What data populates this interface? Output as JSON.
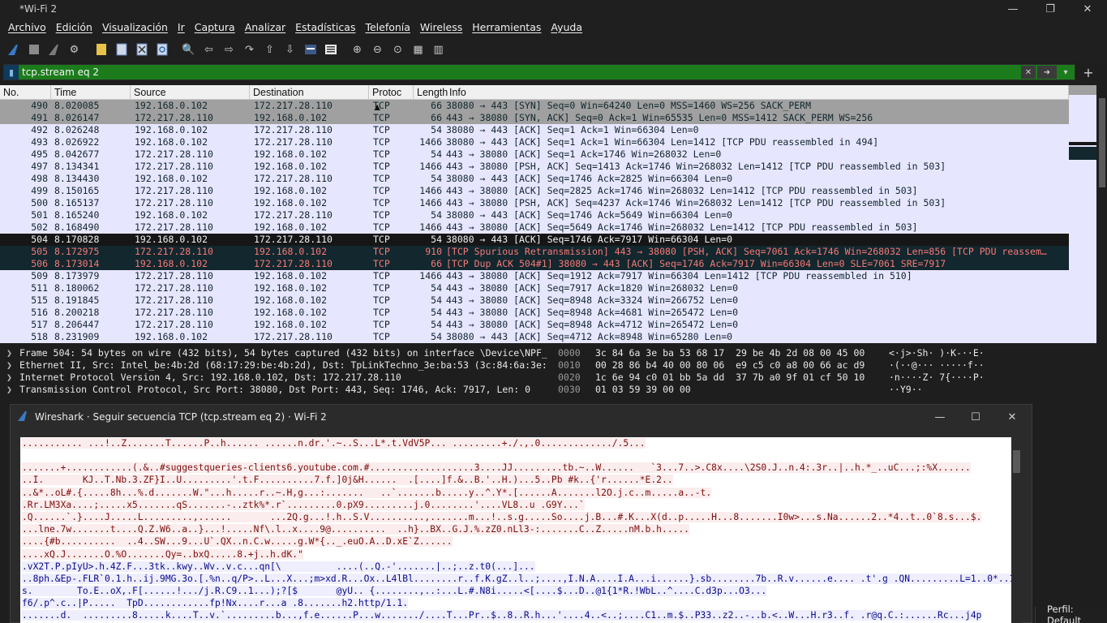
{
  "window": {
    "title": "*Wi-Fi 2"
  },
  "menu": [
    "Archivo",
    "Edición",
    "Visualización",
    "Ir",
    "Captura",
    "Analizar",
    "Estadísticas",
    "Telefonía",
    "Wireless",
    "Herramientas",
    "Ayuda"
  ],
  "filter": {
    "value": "tcp.stream eq 2"
  },
  "columns": {
    "no": "No.",
    "time": "Time",
    "source": "Source",
    "destination": "Destination",
    "protocol": "Protoc ▲",
    "length": "Length",
    "info": "Info"
  },
  "packets": [
    {
      "no": "490",
      "time": "8.020085",
      "src": "192.168.0.102",
      "dst": "172.217.28.110",
      "proto": "TCP",
      "len": "66",
      "info": "38080 → 443 [SYN] Seq=0 Win=64240 Len=0 MSS=1460 WS=256 SACK_PERM",
      "style": "syn"
    },
    {
      "no": "491",
      "time": "8.026147",
      "src": "172.217.28.110",
      "dst": "192.168.0.102",
      "proto": "TCP",
      "len": "66",
      "info": "443 → 38080 [SYN, ACK] Seq=0 Ack=1 Win=65535 Len=0 MSS=1412 SACK_PERM WS=256",
      "style": "syn"
    },
    {
      "no": "492",
      "time": "8.026248",
      "src": "192.168.0.102",
      "dst": "172.217.28.110",
      "proto": "TCP",
      "len": "54",
      "info": "38080 → 443 [ACK] Seq=1 Ack=1 Win=66304 Len=0",
      "style": "norm"
    },
    {
      "no": "493",
      "time": "8.026922",
      "src": "192.168.0.102",
      "dst": "172.217.28.110",
      "proto": "TCP",
      "len": "1466",
      "info": "38080 → 443 [ACK] Seq=1 Ack=1 Win=66304 Len=1412 [TCP PDU reassembled in 494]",
      "style": "norm"
    },
    {
      "no": "495",
      "time": "8.042677",
      "src": "172.217.28.110",
      "dst": "192.168.0.102",
      "proto": "TCP",
      "len": "54",
      "info": "443 → 38080 [ACK] Seq=1 Ack=1746 Win=268032 Len=0",
      "style": "norm"
    },
    {
      "no": "497",
      "time": "8.134341",
      "src": "172.217.28.110",
      "dst": "192.168.0.102",
      "proto": "TCP",
      "len": "1466",
      "info": "443 → 38080 [PSH, ACK] Seq=1413 Ack=1746 Win=268032 Len=1412 [TCP PDU reassembled in 503]",
      "style": "norm"
    },
    {
      "no": "498",
      "time": "8.134430",
      "src": "192.168.0.102",
      "dst": "172.217.28.110",
      "proto": "TCP",
      "len": "54",
      "info": "38080 → 443 [ACK] Seq=1746 Ack=2825 Win=66304 Len=0",
      "style": "norm"
    },
    {
      "no": "499",
      "time": "8.150165",
      "src": "172.217.28.110",
      "dst": "192.168.0.102",
      "proto": "TCP",
      "len": "1466",
      "info": "443 → 38080 [ACK] Seq=2825 Ack=1746 Win=268032 Len=1412 [TCP PDU reassembled in 503]",
      "style": "norm"
    },
    {
      "no": "500",
      "time": "8.165137",
      "src": "172.217.28.110",
      "dst": "192.168.0.102",
      "proto": "TCP",
      "len": "1466",
      "info": "443 → 38080 [PSH, ACK] Seq=4237 Ack=1746 Win=268032 Len=1412 [TCP PDU reassembled in 503]",
      "style": "norm"
    },
    {
      "no": "501",
      "time": "8.165240",
      "src": "192.168.0.102",
      "dst": "172.217.28.110",
      "proto": "TCP",
      "len": "54",
      "info": "38080 → 443 [ACK] Seq=1746 Ack=5649 Win=66304 Len=0",
      "style": "norm"
    },
    {
      "no": "502",
      "time": "8.168490",
      "src": "172.217.28.110",
      "dst": "192.168.0.102",
      "proto": "TCP",
      "len": "1466",
      "info": "443 → 38080 [ACK] Seq=5649 Ack=1746 Win=268032 Len=1412 [TCP PDU reassembled in 503]",
      "style": "norm"
    },
    {
      "no": "504",
      "time": "8.170828",
      "src": "192.168.0.102",
      "dst": "172.217.28.110",
      "proto": "TCP",
      "len": "54",
      "info": "38080 → 443 [ACK] Seq=1746 Ack=7917 Win=66304 Len=0",
      "style": "sel"
    },
    {
      "no": "505",
      "time": "8.172975",
      "src": "172.217.28.110",
      "dst": "192.168.0.102",
      "proto": "TCP",
      "len": "910",
      "info": "[TCP Spurious Retransmission] 443 → 38080 [PSH, ACK] Seq=7061 Ack=1746 Win=268032 Len=856 [TCP PDU reassem…",
      "style": "bad"
    },
    {
      "no": "506",
      "time": "8.173014",
      "src": "192.168.0.102",
      "dst": "172.217.28.110",
      "proto": "TCP",
      "len": "66",
      "info": "[TCP Dup ACK 504#1] 38080 → 443 [ACK] Seq=1746 Ack=7917 Win=66304 Len=0 SLE=7061 SRE=7917",
      "style": "bad"
    },
    {
      "no": "509",
      "time": "8.173979",
      "src": "172.217.28.110",
      "dst": "192.168.0.102",
      "proto": "TCP",
      "len": "1466",
      "info": "443 → 38080 [ACK] Seq=1912 Ack=7917 Win=66304 Len=1412 [TCP PDU reassembled in 510]",
      "style": "norm"
    },
    {
      "no": "511",
      "time": "8.180062",
      "src": "172.217.28.110",
      "dst": "192.168.0.102",
      "proto": "TCP",
      "len": "54",
      "info": "443 → 38080 [ACK] Seq=7917 Ack=1820 Win=268032 Len=0",
      "style": "norm"
    },
    {
      "no": "515",
      "time": "8.191845",
      "src": "172.217.28.110",
      "dst": "192.168.0.102",
      "proto": "TCP",
      "len": "54",
      "info": "443 → 38080 [ACK] Seq=8948 Ack=3324 Win=266752 Len=0",
      "style": "norm"
    },
    {
      "no": "516",
      "time": "8.200218",
      "src": "172.217.28.110",
      "dst": "192.168.0.102",
      "proto": "TCP",
      "len": "54",
      "info": "443 → 38080 [ACK] Seq=8948 Ack=4681 Win=265472 Len=0",
      "style": "norm"
    },
    {
      "no": "517",
      "time": "8.206447",
      "src": "172.217.28.110",
      "dst": "192.168.0.102",
      "proto": "TCP",
      "len": "54",
      "info": "443 → 38080 [ACK] Seq=8948 Ack=4712 Win=265472 Len=0",
      "style": "norm"
    },
    {
      "no": "518",
      "time": "8.231909",
      "src": "192.168.0.102",
      "dst": "172.217.28.110",
      "proto": "TCP",
      "len": "54",
      "info": "38080 → 443 [ACK] Seq=4712 Ack=8948 Win=65280 Len=0",
      "style": "norm"
    }
  ],
  "details": [
    "Frame 504: 54 bytes on wire (432 bits), 54 bytes captured (432 bits) on interface \\Device\\NPF_",
    "Ethernet II, Src: Intel_be:4b:2d (68:17:29:be:4b:2d), Dst: TpLinkTechno_3e:ba:53 (3c:84:6a:3e:",
    "Internet Protocol Version 4, Src: 192.168.0.102, Dst: 172.217.28.110",
    "Transmission Control Protocol, Src Port: 38080, Dst Port: 443, Seq: 1746, Ack: 7917, Len: 0"
  ],
  "hex": [
    {
      "off": "0000",
      "bytes": "3c 84 6a 3e ba 53 68 17  29 be 4b 2d 08 00 45 00",
      "ascii": "<·j>·Sh· )·K-··E·"
    },
    {
      "off": "0010",
      "bytes": "00 28 86 b4 40 00 80 06  e9 c5 c0 a8 00 66 ac d9",
      "ascii": "·(··@··· ·····f··"
    },
    {
      "off": "0020",
      "bytes": "1c 6e 94 c0 01 bb 5a dd  37 7b a0 9f 01 cf 50 10",
      "ascii": "·n····Z· 7{····P·"
    },
    {
      "off": "0030",
      "bytes": "01 03 59 39 00 00",
      "ascii": "··Y9··"
    }
  ],
  "dialog": {
    "title": "Wireshark · Seguir secuencia TCP (tcp.stream eq 2) · Wi-Fi 2",
    "stream": [
      {
        "who": "cl",
        "text": "........... ...!..Z.......T......P..h...... ......n.dr.'.~..S...L*.t.VdV5P... .........+./.,.0............./.5..."
      },
      {
        "who": "gap",
        "text": ""
      },
      {
        "who": "cl",
        "text": ".......+............(.&..#suggestqueries-clients6.youtube.com.#...................3....JJ.........tb.~..W......   `3...7..>.C8x....\\2S0.J..n.4:.3r..|..h.*_..uC...;:%X......"
      },
      {
        "who": "cl",
        "text": "..I.       KJ..T.Nb.3.ZF}I..U.........'.t.F..........7.f.]0j&H......  .[....]f.&..B.'..H.)...5..Pb #k..{'r......*E.2.."
      },
      {
        "who": "cl",
        "text": "..&*..oL#.{.....8h...%.d.......W.\"...h.....r..~.H,g...:.......   ..`.......b.....y..^.Y*.[......A.......l2O.j.c..m.....a..-t."
      },
      {
        "who": "cl",
        "text": ".Rr.LM3Xa....;.....x5.......qS.......-..ztk%*.r`.........0.pX9.........j.0........'....VL8..u .G9Y...`"
      },
      {
        "who": "cl",
        "text": ".Q......`.}....J.....L.........,......       ...2Q.g...!.h..S.V..........,.......m...!..s.g.....So....j.B...#.K...X(d..p.....H...8.......I0w>...s.Na......2..*4..t..0`8.s...$."
      },
      {
        "who": "cl",
        "text": "...lne.7w.......t....Q.Z.W6..a..}...!.....Nf\\.l..x....9@..........  ..h}..BX..G.J.%.zZ0.nLl3-:.......C..Z.....nM.b.h....."
      },
      {
        "who": "cl",
        "text": "....{#b..........  ..4..SW...9...U`.QX..n.C.w.....g.W*{.._.euO.A..D.xE`Z......"
      },
      {
        "who": "cl",
        "text": "....xQ.J.......O.%O.......Qy=..bxQ.....8.+j..h.dK.\""
      },
      {
        "who": "sv",
        "text": ".vX2T.P.pIyU>.h.4Z.F...3tk..kwy..Wv..v.c...qn[\\          ....(..Q.-'.......|..;..z.t0(...]..."
      },
      {
        "who": "sv",
        "text": "..8ph.&Ep-.FLR`0.1.h..ij.9MG.3o.[.%n..q/P>..L...X...;m>xd.R...Ox..L4lBl........r..f.K.gZ..l..;....,I.N.A....I.A...i......}.sb........7b..R.v......e.... .t'.g .QN.........L=1..0*..1"
      },
      {
        "who": "sv",
        "text": "s.        To.E..oX,.F[......!.../j.R.C9..1...);?[$       @yU.. {........,..:...L.#.N8i.....<[....$...D..@1{1*R.!WbL..^....C.d3p...O3..."
      },
      {
        "who": "sv",
        "text": "f6/.p^.c..|P.....  TpD............fp!Nx....r...a .8.......h2.http/1.1."
      },
      {
        "who": "sv",
        "text": ".......d.  .........8.....k....T..v.`.........b...,f.e......P...w......./....T...Pr..$..8..R.h...'....4..<..;....C1..m.$..P33..z2..-..b.<..W...H.r3..f. .r@q.C.:......Rc...j4p"
      }
    ]
  },
  "status": {
    "profile": "Perfil: Default"
  }
}
